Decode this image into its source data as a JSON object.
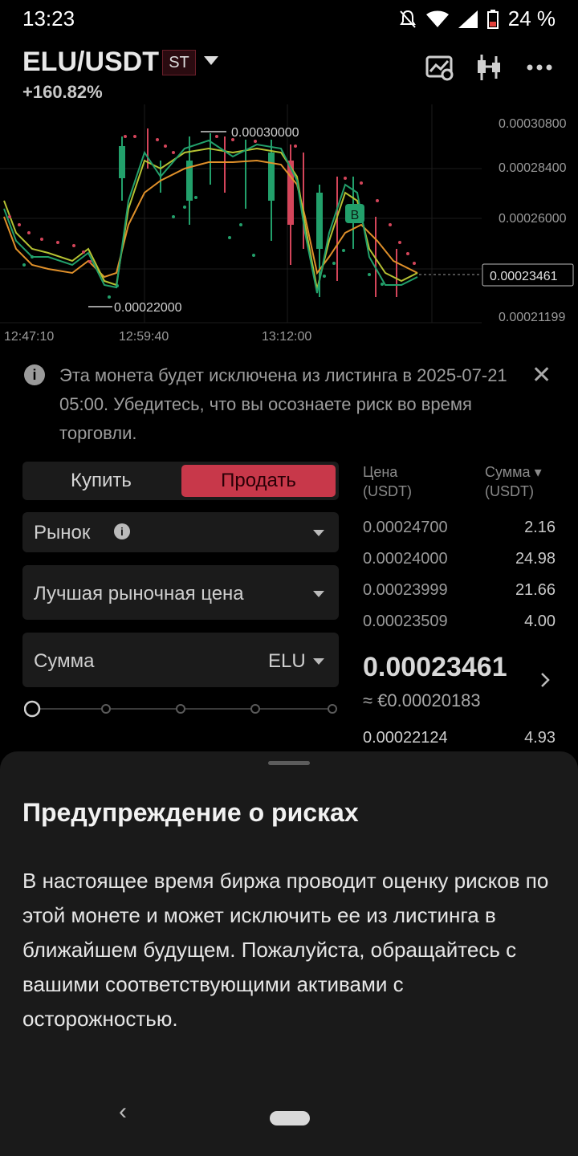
{
  "status_bar": {
    "time": "13:23",
    "battery": "24 %"
  },
  "header": {
    "pair": "ELU/USDT",
    "badge": "ST",
    "change": "+160.82%"
  },
  "chart": {
    "y_ticks": [
      "0.00030800",
      "0.00028400",
      "0.00026000",
      "0.00021199"
    ],
    "x_ticks": [
      "12:47:10",
      "12:59:40",
      "13:12:00"
    ],
    "high_label": "0.00030000",
    "low_label": "0.00022000",
    "current_label": "0.00023461",
    "marker": "B",
    "colors": {
      "up": "#22a06b",
      "down": "#d4455a",
      "ma1": "#e0902a",
      "ma2": "#b6c233",
      "ma3": "#8a9d2e"
    }
  },
  "notice": {
    "text": "Эта монета будет исключена из листинга в 2025-07-21 05:00. Убедитесь, что вы осознаете риск во время торговли."
  },
  "order_form": {
    "buy_label": "Купить",
    "sell_label": "Продать",
    "order_type": "Рынок",
    "price_mode": "Лучшая рыночная цена",
    "amount_label": "Сумма",
    "amount_unit": "ELU"
  },
  "order_book": {
    "price_header": "Цена",
    "price_unit": "(USDT)",
    "amount_header": "Сумма",
    "amount_unit": "(USDT)",
    "asks": [
      {
        "price": "0.00024700",
        "amount": "2.16"
      },
      {
        "price": "0.00024000",
        "amount": "24.98"
      },
      {
        "price": "0.00023999",
        "amount": "21.66"
      },
      {
        "price": "0.00023509",
        "amount": "4.00"
      }
    ],
    "last_price": "0.00023461",
    "eur_price": "≈ €0.00020183",
    "bid": {
      "price": "0.00022124",
      "amount": "4.93"
    }
  },
  "sheet": {
    "title": "Предупреждение о рисках",
    "body": "В настоящее время биржа проводит оценку рисков по этой монете и может исключить ее из листинга в ближайшем будущем. Пожалуйста, обращайтесь с вашими соответствующими активами с осторожностью."
  }
}
